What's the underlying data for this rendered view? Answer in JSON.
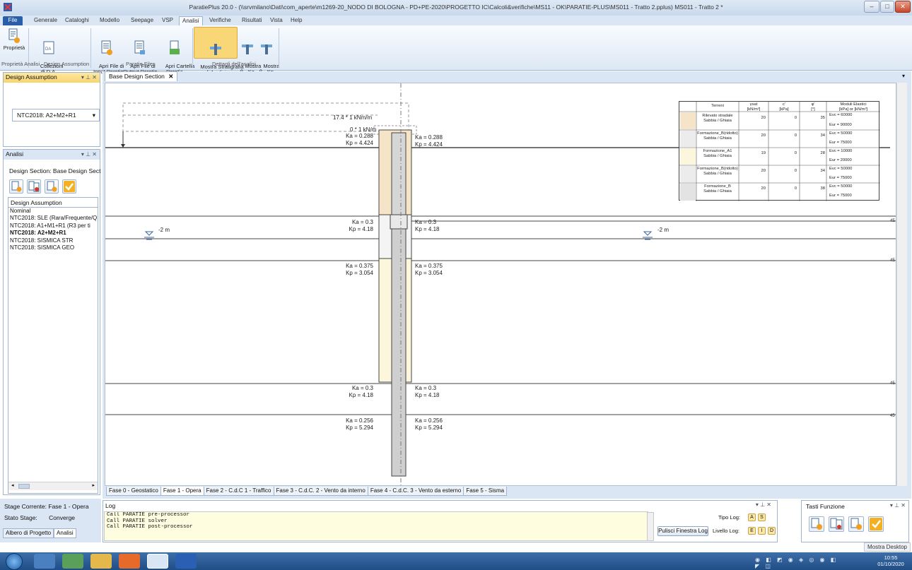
{
  "window": {
    "title": "ParatiePlus 20.0 - (\\\\srvmilano\\Dati\\com_aperte\\m1269-20_NODO DI BOLOGNA - PD+PE-2020\\PROGETTO IC\\Calcoli&verifiche\\MS11 - OK\\PARATIE-PLUS\\MS011 - Tratto 2.pplus) MS011 - Tratto 2 *",
    "buttons": {
      "minimize": "–",
      "maximize": "□",
      "close": "✕"
    }
  },
  "menu": [
    "File",
    "Generale",
    "Cataloghi",
    "Modello",
    "Seepage",
    "VSP",
    "Analisi",
    "Verifiche",
    "Risultati",
    "Vista",
    "Help"
  ],
  "ribbon": {
    "buttons": [
      {
        "label": "Proprietà",
        "icon": "properties-icon"
      },
      {
        "label": "Collezioni\ndi D.A.",
        "icon": "collection-icon"
      },
      {
        "label": "Apri File di\nInput Paratie",
        "icon": "open-input-file-icon"
      },
      {
        "label": "Apri File di\nOutput Paratie",
        "icon": "open-output-file-icon"
      },
      {
        "label": "Apri Cartella\nParatie",
        "icon": "open-folder-icon"
      },
      {
        "label": "Mostra Stratigrafia\ndi Analisi",
        "icon": "stratigraphy-icon"
      },
      {
        "label": "Mostra\nβ - Ka",
        "icon": "beta-ka-icon"
      },
      {
        "label": "Mostra\nβ - Kp",
        "icon": "beta-kp-icon"
      }
    ],
    "groups": [
      "Proprietà Analisi",
      "Design Assumption",
      "Paratie Files",
      "Dettagli dell'analisi"
    ]
  },
  "design_assumption_panel": {
    "title": "Design Assumption",
    "selected": "NTC2018: A2+M2+R1"
  },
  "analisi_panel": {
    "title": "Analisi",
    "design_section_label": "Design Section:",
    "design_section_value": "Base Design Sect",
    "list_header": "Design Assumption",
    "items": [
      "Nominal",
      "NTC2018: SLE (Rara/Frequente/Q",
      "NTC2018: A1+M1+R1 (R3 per ti",
      "NTC2018: A2+M2+R1",
      "NTC2018: SISMICA STR",
      "NTC2018: SISMICA GEO"
    ],
    "selected": "NTC2018: A2+M2+R1"
  },
  "status": {
    "stage_label": "Stage Corrente:",
    "stage_value": "Fase 1 - Opera",
    "state_label": "Stato Stage:",
    "state_value": "Converge",
    "tabs": [
      "Albero di Progetto",
      "Analisi"
    ]
  },
  "document": {
    "tab": "Base Design Section",
    "load_labels": [
      "17.4 * 1 kNm/m",
      "0 * 1 kN/m"
    ],
    "water_levels": [
      "-2 m",
      "-2 m"
    ],
    "left_coeffs": [
      [
        "Ka = 0.288",
        "Kp = 4.424"
      ],
      [
        "Ka = 0.3",
        "Kp = 4.18"
      ],
      [
        "Ka = 0.375",
        "Kp = 3.054"
      ],
      [
        "Ka = 0.3",
        "Kp = 4.18"
      ],
      [
        "Ka = 0.256",
        "Kp = 5.294"
      ]
    ],
    "right_coeffs": [
      [
        "Ka = 0.288",
        "Kp = 4.424"
      ],
      [
        "Ka = 0.3",
        "Kp = 4.18"
      ],
      [
        "Ka = 0.375",
        "Kp = 3.054"
      ],
      [
        "Ka = 0.3",
        "Kp = 4.18"
      ],
      [
        "Ka = 0.256",
        "Kp = 5.294"
      ]
    ],
    "edge_marks": [
      "45",
      "45",
      "45",
      "45"
    ],
    "legend": {
      "headers": [
        "Terreni",
        "γsat\n[kN/m³]",
        "c'\n[kPa]",
        "φ'\n[°]",
        "Moduli Elastici\n[kPa] or [kN/m³]"
      ],
      "rows": [
        {
          "name": "Rilevato stradale\nSabbia / Ghiaia",
          "gamma": "20",
          "c": "0",
          "phi": "35",
          "evc": "Evc = 60000",
          "eur": "Eur = 90000",
          "color": "#f6e4c8"
        },
        {
          "name": "Formazione_B(ridotto)\nSabbia / Ghiaia",
          "gamma": "20",
          "c": "0",
          "phi": "34",
          "evc": "Evc = 50000",
          "eur": "Eur = 75000",
          "color": "#ececec"
        },
        {
          "name": "Formazione_A1\nSabbia / Ghiaia",
          "gamma": "19",
          "c": "0",
          "phi": "28",
          "evc": "Evc = 10000",
          "eur": "Eur = 20000",
          "color": "#fbf6dc"
        },
        {
          "name": "Formazione_B(ridotto)\nSabbia / Ghiaia",
          "gamma": "20",
          "c": "0",
          "phi": "34",
          "evc": "Evc = 50000",
          "eur": "Eur = 75000",
          "color": "#ececec"
        },
        {
          "name": "Formazione_B\nSabbia / Ghiaia",
          "gamma": "20",
          "c": "0",
          "phi": "38",
          "evc": "Evc = 50000",
          "eur": "Eur = 75000",
          "color": "#e3e3e3"
        }
      ]
    },
    "phases": [
      "Fase 0 - Geostatico",
      "Fase 1 - Opera",
      "Fase 2 - C.d.C 1 - Traffico",
      "Fase 3 - C.d.C. 2 - Vento da interno",
      "Fase 4 - C.d.C. 3 - Vento da esterno",
      "Fase 5 - Sisma"
    ],
    "active_phase": "Fase 1 - Opera"
  },
  "log": {
    "title": "Log",
    "lines": [
      "Call PARATIE pre-processor",
      "Call PARATIE solver",
      "Call PARATIE post-processor"
    ],
    "clear_button": "Pulisci Finestra Log",
    "tipo_label": "Tipo Log:",
    "tipo_badges": [
      "A",
      "S"
    ],
    "livello_label": "Livello Log:",
    "livello_badges": [
      "E",
      "I",
      "D"
    ]
  },
  "tasti_funzione": {
    "title": "Tasti Funzione"
  },
  "taskbar": {
    "show_desktop": "Mostra Desktop",
    "time": "10:55",
    "date": "01/10/2020"
  }
}
